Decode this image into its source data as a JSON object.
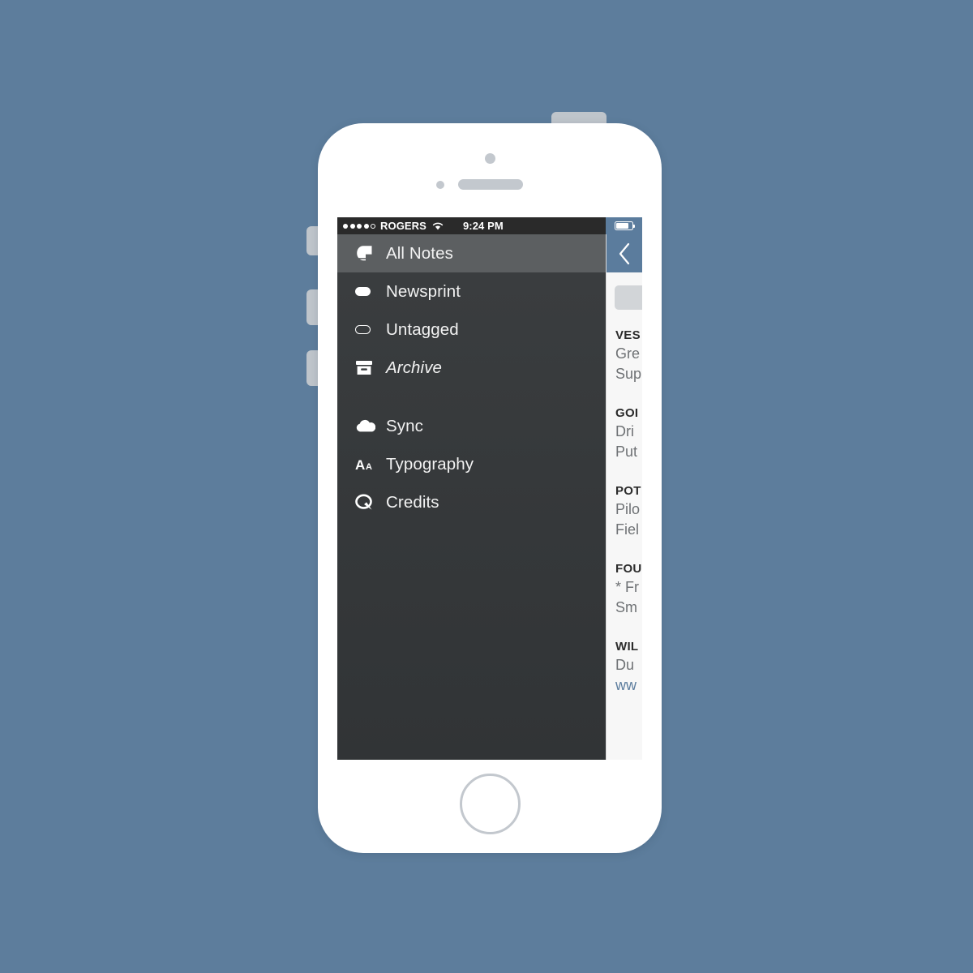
{
  "theme": {
    "background_color": "#5d7d9c",
    "device_body_color": "#ffffff",
    "sidebar_color": "#373a3c",
    "selected_row_color": "#5c5f61",
    "accent_color": "#5b7c9d",
    "status_bar_color": "#2a2a2a",
    "note_list_background": "#f7f7f7",
    "link_color": "#5b7c9d"
  },
  "status_bar": {
    "signal_dots_filled": 4,
    "signal_dots_empty": 1,
    "carrier": "ROGERS",
    "wifi_icon": "wifi-icon",
    "time": "9:24 PM",
    "battery_icon": "battery-icon",
    "battery_level_percent": 78
  },
  "sidebar": {
    "primary_items": [
      {
        "label": "All Notes",
        "icon": "vesper-notes-icon",
        "selected": true,
        "italic": false
      },
      {
        "label": "Newsprint",
        "icon": "tag-filled-icon",
        "selected": false,
        "italic": false
      },
      {
        "label": "Untagged",
        "icon": "tag-outline-icon",
        "selected": false,
        "italic": false
      },
      {
        "label": "Archive",
        "icon": "archive-box-icon",
        "selected": false,
        "italic": true
      }
    ],
    "secondary_items": [
      {
        "label": "Sync",
        "icon": "cloud-icon",
        "selected": false,
        "italic": false
      },
      {
        "label": "Typography",
        "icon": "aa-text-size-icon",
        "selected": false,
        "italic": false
      },
      {
        "label": "Credits",
        "icon": "credits-q-icon",
        "selected": false,
        "italic": false
      }
    ]
  },
  "note_list": {
    "back_button_icon": "chevron-left-icon",
    "search_placeholder": "",
    "items": [
      {
        "title": "VES",
        "line1": "Gre",
        "line2": "Sup",
        "line2_is_link": false
      },
      {
        "title": "GOI",
        "line1": "Dri",
        "line2": "Put",
        "line2_is_link": false
      },
      {
        "title": "POT",
        "line1": "Pilo",
        "line2": "Fiel",
        "line2_is_link": false
      },
      {
        "title": "FOU",
        "line1": "* Fr",
        "line2": "Sm",
        "line2_is_link": false
      },
      {
        "title": "WIL",
        "line1": "Du",
        "line2": "ww",
        "line2_is_link": true
      }
    ]
  },
  "device": {
    "power_button": "power-button",
    "mute_switch": "mute-switch",
    "volume_up_button": "volume-up-button",
    "volume_down_button": "volume-down-button",
    "home_button": "home-button",
    "front_camera": "front-camera",
    "earpiece_speaker": "earpiece-speaker",
    "proximity_sensor": "proximity-sensor"
  }
}
